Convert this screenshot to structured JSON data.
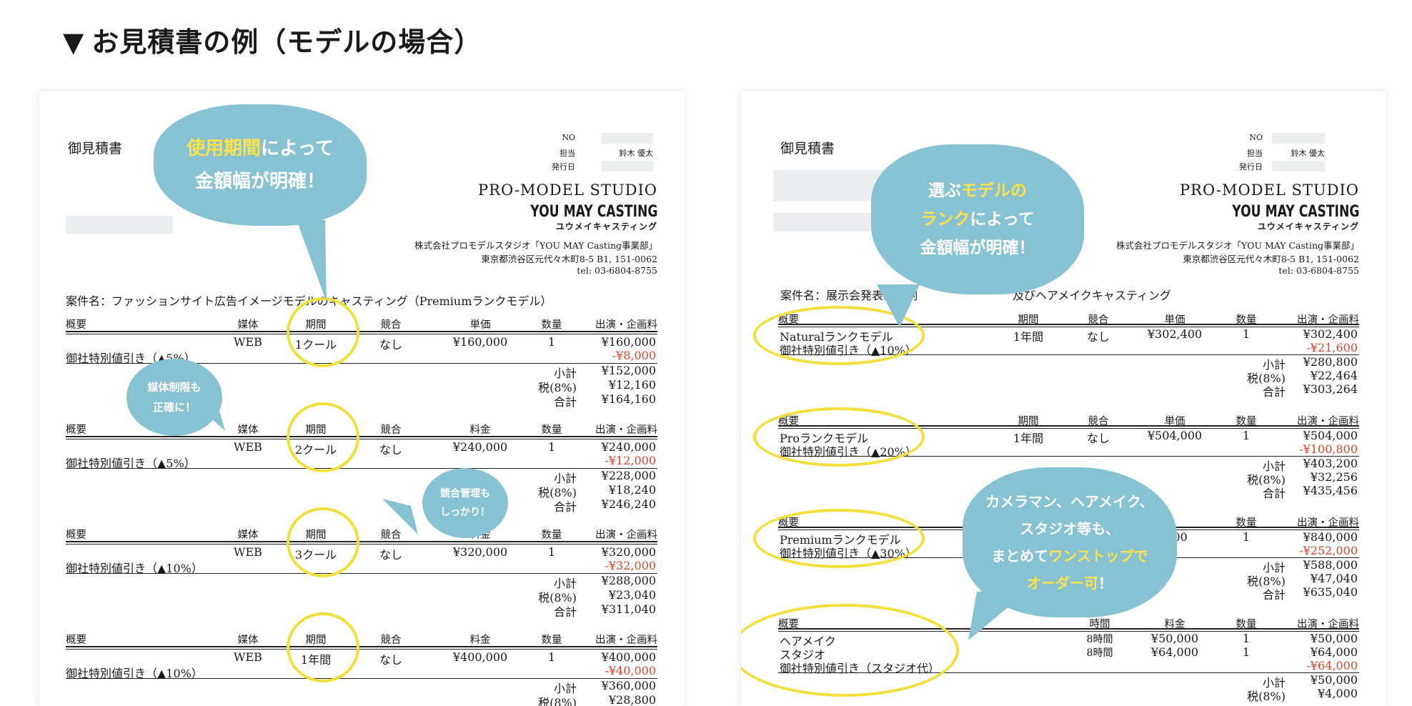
{
  "heading": {
    "marker": "▼",
    "text": "お見積書の例（モデルの場合）"
  },
  "colors": {
    "bubble": "#86c2d2",
    "highlight": "#ffe24a",
    "circle": "#f3df3a",
    "discount": "#e0412a"
  },
  "left": {
    "title": "御見積書",
    "meta": {
      "no": "NO",
      "tanto": "担当",
      "tanto_name": "鈴木 優太",
      "date": "発行日"
    },
    "studio": "PRO-MODEL STUDIO",
    "ymc": "YOU MAY CASTING",
    "ymk": "ユウメイキャスティング",
    "addr": [
      "株式会社プロモデルスタジオ「YOU MAY Casting事業部」",
      "東京都渋谷区元代々木町8-5 B1, 151-0062",
      "tel: 03-6804-8755"
    ],
    "subject": "案件名：ファッションサイト広告イメージモデルのキャスティング（Premiumランクモデル）",
    "blocks": [
      {
        "h": [
          "概要",
          "媒体",
          "期間",
          "競合",
          "単価",
          "数量",
          "出演・企画料"
        ],
        "row": [
          "WEB",
          "1クール",
          "なし",
          "¥160,000",
          "1",
          "¥160,000"
        ],
        "disc_label": "御社特別値引き（▲5%）",
        "disc": "-¥8,000",
        "sub": [
          "小計",
          "¥152,000"
        ],
        "tax": [
          "税(8%)",
          "¥12,160"
        ],
        "total": [
          "合計",
          "¥164,160"
        ]
      },
      {
        "h": [
          "概要",
          "媒体",
          "期間",
          "競合",
          "料金",
          "数量",
          "出演・企画料"
        ],
        "row": [
          "WEB",
          "2クール",
          "なし",
          "¥240,000",
          "1",
          "¥240,000"
        ],
        "disc_label": "御社特別値引き（▲5%）",
        "disc": "-¥12,000",
        "sub": [
          "小計",
          "¥228,000"
        ],
        "tax": [
          "税(8%)",
          "¥18,240"
        ],
        "total": [
          "合計",
          "¥246,240"
        ]
      },
      {
        "h": [
          "概要",
          "媒体",
          "期間",
          "競合",
          "料金",
          "数量",
          "出演・企画料"
        ],
        "row": [
          "WEB",
          "3クール",
          "なし",
          "¥320,000",
          "1",
          "¥320,000"
        ],
        "disc_label": "御社特別値引き（▲10%）",
        "disc": "-¥32,000",
        "sub": [
          "小計",
          "¥288,000"
        ],
        "tax": [
          "税(8%)",
          "¥23,040"
        ],
        "total": [
          "合計",
          "¥311,040"
        ]
      },
      {
        "h": [
          "概要",
          "媒体",
          "期間",
          "競合",
          "料金",
          "数量",
          "出演・企画料"
        ],
        "row": [
          "WEB",
          "1年間",
          "なし",
          "¥400,000",
          "1",
          "¥400,000"
        ],
        "disc_label": "御社特別値引き（▲10%）",
        "disc": "-¥40,000",
        "sub": [
          "小計",
          "¥360,000"
        ],
        "tax": [
          "税(8%)",
          "¥28,800"
        ],
        "total": [
          "合計",
          ""
        ]
      }
    ],
    "bubbles": {
      "b1a": "使用期間",
      "b1b": "によって",
      "b1c": "金額幅が明確！",
      "b2a": "媒体制限も",
      "b2b": "正確に！",
      "b3a": "競合管理も",
      "b3b": "しっかり！"
    }
  },
  "right": {
    "title": "御見積書",
    "meta": {
      "no": "NO",
      "tanto": "担当",
      "tanto_name": "鈴木 優太",
      "date": "発行日"
    },
    "studio": "PRO-MODEL STUDIO",
    "ymc": "YOU MAY CASTING",
    "ymk": "ユウメイキャスティング",
    "addr": [
      "株式会社プロモデルスタジオ「YOU MAY Casting事業部」",
      "東京都渋谷区元代々木町8-5 B1, 151-0062",
      "tel: 03-6804-8755"
    ],
    "subject_a": "案件名：展示会発表映像制",
    "subject_b": "及びヘアメイクキャスティング",
    "blocks": [
      {
        "h": [
          "概要",
          "期間",
          "競合",
          "単価",
          "数量",
          "出演・企画料"
        ],
        "item": "Naturalランクモデル",
        "row": [
          "1年間",
          "なし",
          "¥302,400",
          "1",
          "¥302,400"
        ],
        "disc_label": "御社特別値引き（▲10%）",
        "disc": "-¥21,600",
        "sub": [
          "小計",
          "¥280,800"
        ],
        "tax": [
          "税(8%)",
          "¥22,464"
        ],
        "total": [
          "合計",
          "¥303,264"
        ]
      },
      {
        "h": [
          "概要",
          "期間",
          "競合",
          "単価",
          "数量",
          "出演・企画料"
        ],
        "item": "Proランクモデル",
        "row": [
          "1年間",
          "なし",
          "¥504,000",
          "1",
          "¥504,000"
        ],
        "disc_label": "御社特別値引き（▲20%）",
        "disc": "-¥100,800",
        "sub": [
          "小計",
          "¥403,200"
        ],
        "tax": [
          "税(8%)",
          "¥32,256"
        ],
        "total": [
          "合計",
          "¥435,456"
        ]
      },
      {
        "h": [
          "概要",
          "数量",
          "出演・企画料"
        ],
        "item": "Premiumランクモデル",
        "row": [
          ",000",
          "1",
          "¥840,000"
        ],
        "disc_label": "御社特別値引き（▲30%）",
        "disc": "-¥252,000",
        "sub": [
          "小計",
          "¥588,000"
        ],
        "tax": [
          "税(8%)",
          "¥47,040"
        ],
        "total": [
          "合計",
          "¥635,040"
        ]
      }
    ],
    "staff": {
      "h": [
        "概要",
        "時間",
        "料金",
        "数量",
        "出演・企画料"
      ],
      "rows": [
        [
          "ヘアメイク",
          "8時間",
          "¥50,000",
          "1",
          "¥50,000"
        ],
        [
          "スタジオ",
          "8時間",
          "¥64,000",
          "1",
          "¥64,000"
        ]
      ],
      "disc_label": "御社特別値引き（スタジオ代）",
      "disc": "-¥64,000",
      "sub": [
        "小計",
        "¥50,000"
      ],
      "tax": [
        "税(8%)",
        "¥4,000"
      ]
    },
    "bubbles": {
      "b1a": "選ぶ",
      "b1b": "モデルの",
      "b1c": "ランク",
      "b1d": "によって",
      "b1e": "金額幅が明確！",
      "b2a": "カメラマン、ヘアメイク、",
      "b2b": "スタジオ等も、",
      "b2c": "まとめて",
      "b2d": "ワンストップで",
      "b2e": "オーダー可",
      "b2f": "！"
    }
  }
}
